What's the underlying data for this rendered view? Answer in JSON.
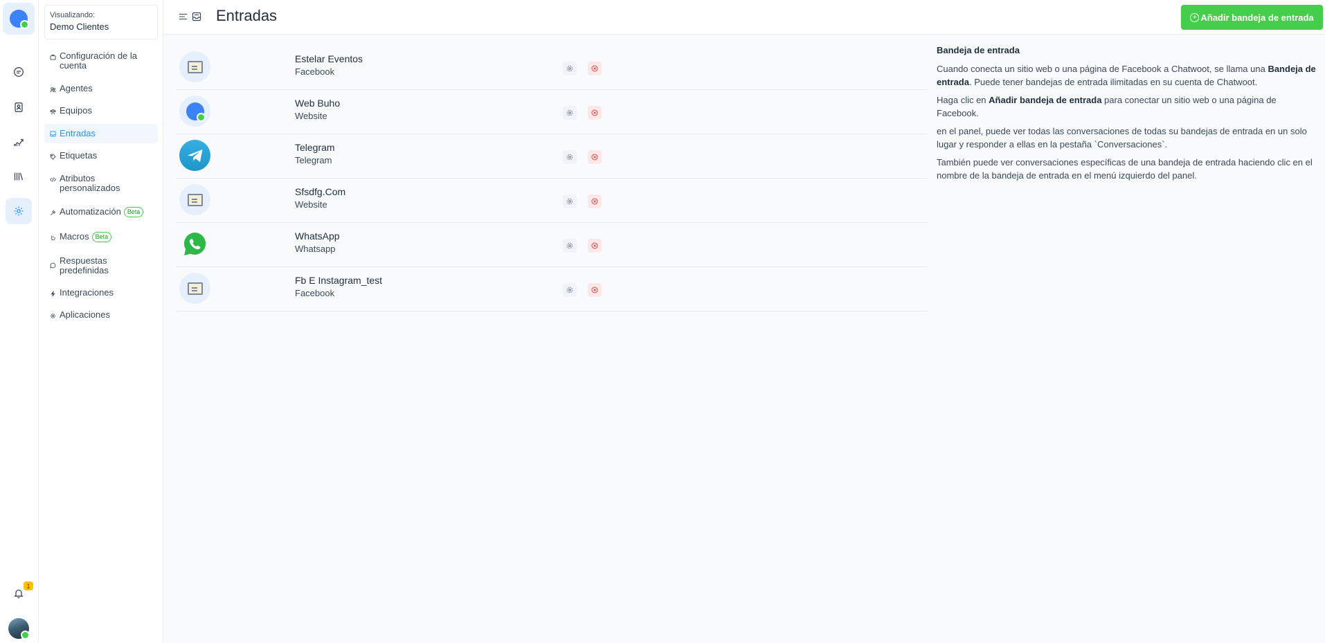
{
  "app": {
    "page_title": "Entradas",
    "add_button_label": "Añadir bandeja de entrada"
  },
  "rail": {
    "icons": [
      "conversations-icon",
      "contacts-icon",
      "reports-icon",
      "library-icon",
      "settings-icon"
    ],
    "notification_count": "1"
  },
  "account": {
    "label": "Visualizando:",
    "name": "Demo Clientes"
  },
  "sidebar": {
    "items": [
      {
        "label": "Configuración de la cuenta",
        "icon": "briefcase-icon"
      },
      {
        "label": "Agentes",
        "icon": "people-icon"
      },
      {
        "label": "Equipos",
        "icon": "team-icon"
      },
      {
        "label": "Entradas",
        "icon": "inbox-icon",
        "active": true
      },
      {
        "label": "Etiquetas",
        "icon": "tag-icon"
      },
      {
        "label": "Atributos personalizados",
        "icon": "code-icon"
      },
      {
        "label": "Automatización",
        "icon": "automation-icon",
        "badge": "Beta"
      },
      {
        "label": "Macros",
        "icon": "macros-icon",
        "badge": "Beta"
      },
      {
        "label": "Respuestas predefinidas",
        "icon": "chat-icon"
      },
      {
        "label": "Integraciones",
        "icon": "flash-icon"
      },
      {
        "label": "Aplicaciones",
        "icon": "apps-icon"
      }
    ]
  },
  "inboxes": [
    {
      "name": "Estelar Eventos",
      "channel": "Facebook",
      "avatar": "generic"
    },
    {
      "name": "Web Buho",
      "channel": "Website",
      "avatar": "website"
    },
    {
      "name": "Telegram",
      "channel": "Telegram",
      "avatar": "telegram"
    },
    {
      "name": "Sfsdfg.Com",
      "channel": "Website",
      "avatar": "generic"
    },
    {
      "name": "WhatsApp",
      "channel": "Whatsapp",
      "avatar": "whatsapp"
    },
    {
      "name": "Fb E Instagram_test",
      "channel": "Facebook",
      "avatar": "generic"
    }
  ],
  "help": {
    "title": "Bandeja de entrada",
    "p1_a": "Cuando conecta un sitio web o una página de Facebook a Chatwoot, se llama una ",
    "p1_b": "Bandeja de entrada",
    "p1_c": ". Puede tener bandejas de entrada ilimitadas en su cuenta de Chatwoot.",
    "p2_a": "Haga clic en ",
    "p2_b": "Añadir bandeja de entrada",
    "p2_c": " para conectar un sitio web o una página de Facebook.",
    "p3": "en el panel, puede ver todas las conversaciones de todas su bandejas de entrada en un solo lugar y responder a ellas en la pestaña `Conversaciones`.",
    "p4": "También puede ver conversaciones específicas de una bandeja de entrada haciendo clic en el nombre de la bandeja de entrada en el menú izquierdo del panel."
  },
  "colors": {
    "accent": "#1f93ff",
    "success": "#44ce4b",
    "danger": "#e0474b"
  }
}
